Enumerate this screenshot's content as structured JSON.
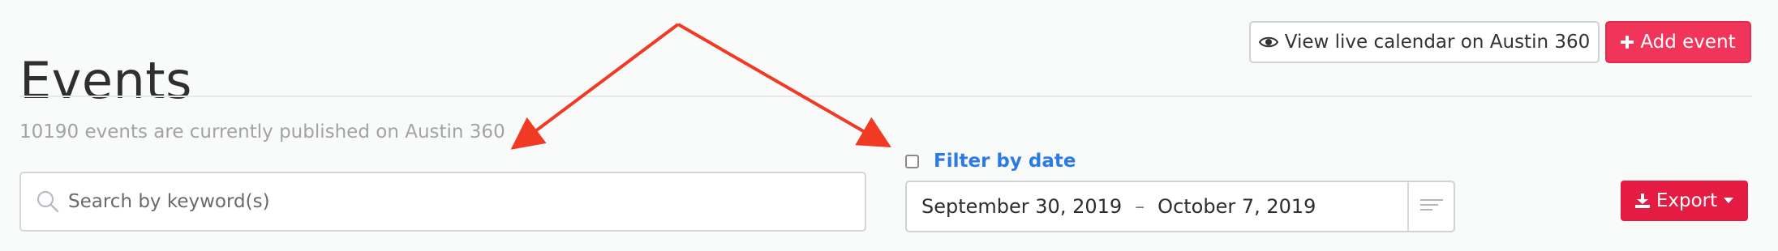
{
  "page": {
    "title": "Events"
  },
  "header": {
    "view_live_label": "View live calendar on Austin 360",
    "add_event_label": "Add event"
  },
  "summary": {
    "text": "10190 events are currently published on Austin 360"
  },
  "search": {
    "placeholder": "Search by keyword(s)",
    "value": ""
  },
  "filter": {
    "label": "Filter by date",
    "checked": false,
    "start_date": "September 30, 2019",
    "separator": "–",
    "end_date": "October 7, 2019"
  },
  "export": {
    "label": "Export"
  },
  "icons": {
    "view": "eye-icon",
    "add": "plus-icon",
    "search": "search-icon",
    "menu": "lines-icon",
    "export": "download-icon",
    "caret": "chevron-down-icon"
  },
  "colors": {
    "accent_red": "#f0345a",
    "export_red": "#e41c44",
    "link_blue": "#2c7be5",
    "annotation_red": "#f03a24"
  }
}
